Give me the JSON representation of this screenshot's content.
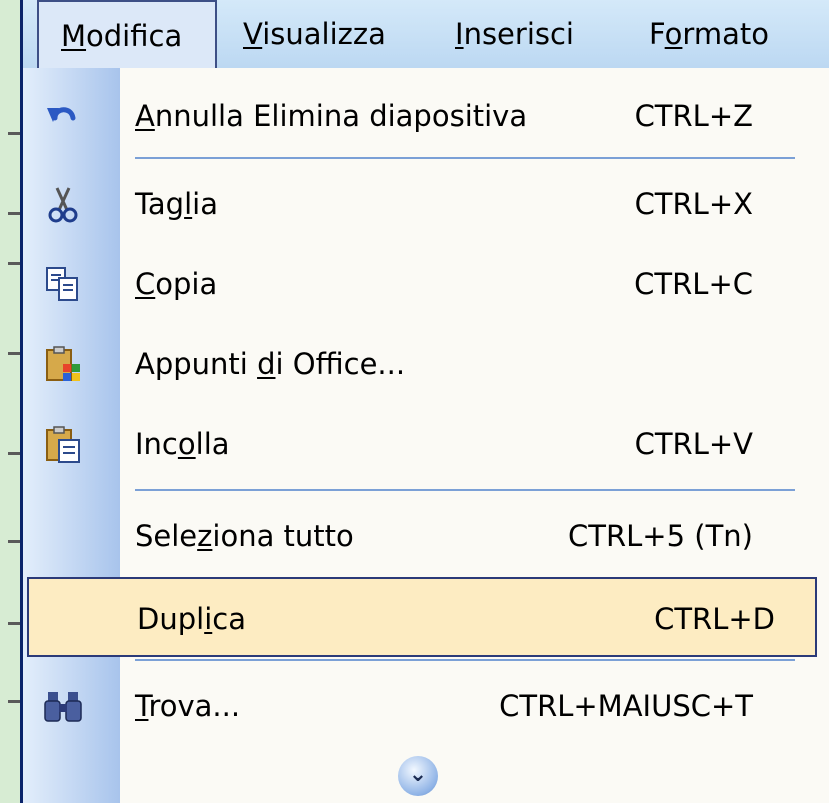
{
  "menubar": {
    "items": [
      {
        "pre": "",
        "ul": "M",
        "post": "odifica"
      },
      {
        "pre": "",
        "ul": "V",
        "post": "isualizza"
      },
      {
        "pre": "",
        "ul": "I",
        "post": "nserisci"
      },
      {
        "pre": "F",
        "ul": "o",
        "post": "rmato"
      }
    ]
  },
  "menu": {
    "items": [
      {
        "pre": "",
        "ul": "A",
        "post": "nnulla Elimina diapositiva",
        "shortcut": "CTRL+Z",
        "icon": "undo-icon"
      },
      {
        "pre": "Tag",
        "ul": "l",
        "post": "ia",
        "shortcut": "CTRL+X",
        "icon": "scissors-icon"
      },
      {
        "pre": "",
        "ul": "C",
        "post": "opia",
        "shortcut": "CTRL+C",
        "icon": "copy-icon"
      },
      {
        "pre": "Appunti ",
        "ul": "d",
        "post": "i Office...",
        "shortcut": "",
        "icon": "office-clipboard-icon"
      },
      {
        "pre": "Inc",
        "ul": "o",
        "post": "lla",
        "shortcut": "CTRL+V",
        "icon": "paste-icon"
      },
      {
        "pre": "Sele",
        "ul": "z",
        "post": "iona tutto",
        "shortcut": "CTRL+5 (Tn)",
        "icon": ""
      },
      {
        "pre": "Dupl",
        "ul": "i",
        "post": "ca",
        "shortcut": "CTRL+D",
        "icon": ""
      },
      {
        "pre": "",
        "ul": "T",
        "post": "rova...",
        "shortcut": "CTRL+MAIUSC+T",
        "icon": "binoculars-icon"
      }
    ],
    "expand_icon": "expand-chevron-icon"
  },
  "colors": {
    "menubar": "#c8e0f6",
    "highlight": "#fdecc2",
    "highlight_border": "#2b3a78",
    "separator": "#7ba0d6"
  }
}
